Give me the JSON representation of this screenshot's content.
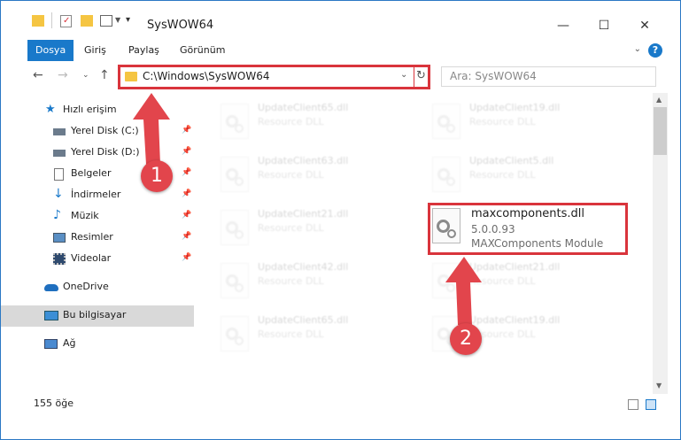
{
  "titlebar": {
    "title": "SysWOW64",
    "minimize": "—",
    "maximize": "☐",
    "close": "✕"
  },
  "ribbon": {
    "tabs": [
      "Dosya",
      "Giriş",
      "Paylaş",
      "Görünüm"
    ],
    "help": "?"
  },
  "nav": {
    "address": "C:\\Windows\\SysWOW64",
    "search_placeholder": "Ara: SysWOW64"
  },
  "sidebar": {
    "items": [
      {
        "label": "Hızlı erişim",
        "icon": "star-icon"
      },
      {
        "label": "Yerel Disk (C:)",
        "icon": "drive-icon"
      },
      {
        "label": "Yerel Disk (D:)",
        "icon": "drive-icon"
      },
      {
        "label": "Belgeler",
        "icon": "documents-icon"
      },
      {
        "label": "İndirmeler",
        "icon": "download-icon"
      },
      {
        "label": "Müzik",
        "icon": "music-icon"
      },
      {
        "label": "Resimler",
        "icon": "pictures-icon"
      },
      {
        "label": "Videolar",
        "icon": "video-icon"
      },
      {
        "label": "OneDrive",
        "icon": "cloud-icon"
      },
      {
        "label": "Bu bilgisayar",
        "icon": "computer-icon"
      },
      {
        "label": "Ağ",
        "icon": "network-icon"
      }
    ]
  },
  "files": {
    "left": [
      {
        "name": "UpdateClient65.dll",
        "type": "Resource DLL"
      },
      {
        "name": "UpdateClient63.dll",
        "type": "Resource DLL"
      },
      {
        "name": "UpdateClient21.dll",
        "type": "Resource DLL"
      },
      {
        "name": "UpdateClient42.dll",
        "type": "Resource DLL"
      },
      {
        "name": "UpdateClient65.dll",
        "type": "Resource DLL"
      }
    ],
    "right": [
      {
        "name": "UpdateClient19.dll",
        "type": "Resource DLL"
      },
      {
        "name": "UpdateClient5.dll",
        "type": "Resource DLL"
      },
      {
        "name": "UpdateClient21.dll",
        "type": "Resource DLL"
      },
      {
        "name": "UpdateClient19.dll",
        "type": "Resource DLL"
      }
    ],
    "highlighted": {
      "name": "maxcomponents.dll",
      "version": "5.0.0.93",
      "description": "MAXComponents Module"
    }
  },
  "status": {
    "count": "155 öğe"
  },
  "annotations": {
    "step1": "1",
    "step2": "2",
    "color": "#e2454c"
  }
}
